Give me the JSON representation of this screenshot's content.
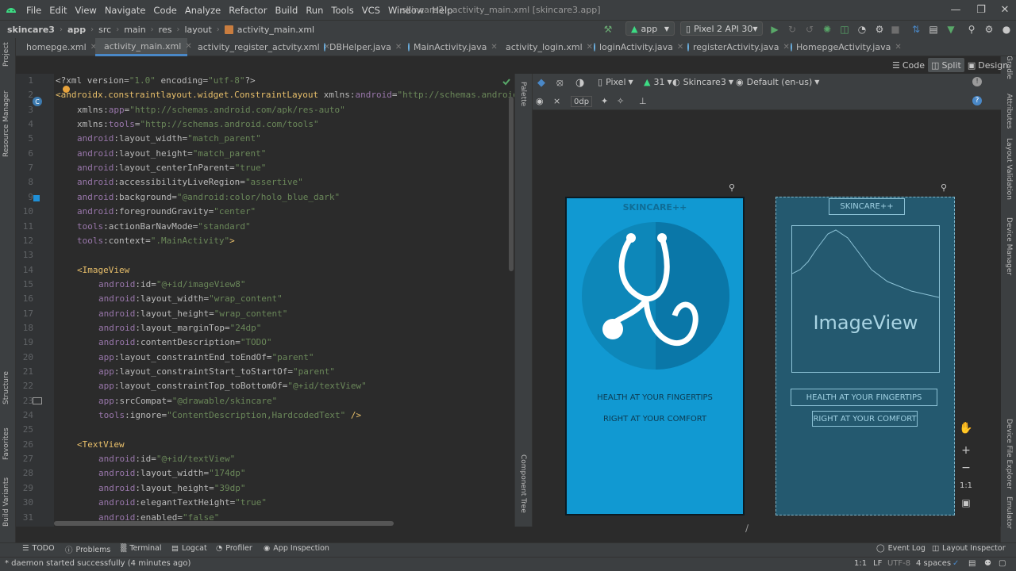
{
  "menu": {
    "items": [
      "File",
      "Edit",
      "View",
      "Navigate",
      "Code",
      "Analyze",
      "Refactor",
      "Build",
      "Run",
      "Tools",
      "VCS",
      "Window",
      "Help"
    ],
    "window_title": "skincare3 - activity_main.xml [skincare3.app]"
  },
  "breadcrumb": [
    "skincare3",
    "app",
    "src",
    "main",
    "res",
    "layout",
    "activity_main.xml"
  ],
  "toolbar": {
    "config_label": "app",
    "device_label": "Pixel 2 API 30"
  },
  "tabs": [
    {
      "label": "homepge.xml",
      "type": "xml"
    },
    {
      "label": "activity_main.xml",
      "type": "xml",
      "active": true
    },
    {
      "label": "activity_register_actvity.xml",
      "type": "xml"
    },
    {
      "label": "DBHelper.java",
      "type": "java"
    },
    {
      "label": "MainActivity.java",
      "type": "java"
    },
    {
      "label": "activity_login.xml",
      "type": "xml"
    },
    {
      "label": "loginActivity.java",
      "type": "java"
    },
    {
      "label": "registerActivity.java",
      "type": "java"
    },
    {
      "label": "HomepgeActivity.java",
      "type": "java"
    }
  ],
  "view_modes": {
    "code": "Code",
    "split": "Split",
    "design": "Design"
  },
  "left_tools": {
    "project": "Project",
    "resource_manager": "Resource Manager",
    "structure": "Structure",
    "favorites": "Favorites",
    "build_variants": "Build Variants"
  },
  "right_tools": {
    "gradle": "Gradle",
    "attributes": "Attributes",
    "layout_validation": "Layout Validation",
    "device_manager": "Device Manager",
    "device_file_explorer": "Device File Explorer",
    "emulator": "Emulator"
  },
  "design_panel": {
    "palette": "Palette",
    "component_tree": "Component Tree",
    "device": "Pixel",
    "api": "31",
    "theme": "Skincare3",
    "locale": "Default (en-us)",
    "margin": "0dp"
  },
  "preview": {
    "title": "SKINCARE++",
    "line1": "HEALTH AT YOUR FINGERTIPS",
    "line2": "RIGHT AT YOUR COMFORT",
    "blueprint_imageview": "ImageView",
    "blue_color": "#0f98d3"
  },
  "code_lines": [
    {
      "n": "1",
      "indent": 0,
      "parts": [
        [
          "prolog",
          "<?xml version="
        ],
        [
          "val",
          "\"1.0\""
        ],
        [
          "prolog",
          " encoding="
        ],
        [
          "val",
          "\"utf-8\""
        ],
        [
          "prolog",
          "?>"
        ]
      ]
    },
    {
      "n": "2",
      "indent": 0,
      "parts": [
        [
          "tag",
          "<androidx.constraintlayout.widget.ConstraintLayout "
        ],
        [
          "attr",
          "xmlns:"
        ],
        [
          "ns",
          "android"
        ],
        [
          "attr",
          "="
        ],
        [
          "val",
          "\"http://schemas.android"
        ]
      ]
    },
    {
      "n": "3",
      "indent": 1,
      "parts": [
        [
          "attr",
          "xmlns:"
        ],
        [
          "ns",
          "app"
        ],
        [
          "attr",
          "="
        ],
        [
          "val",
          "\"http://schemas.android.com/apk/res-auto\""
        ]
      ]
    },
    {
      "n": "4",
      "indent": 1,
      "parts": [
        [
          "attr",
          "xmlns:"
        ],
        [
          "ns",
          "tools"
        ],
        [
          "attr",
          "="
        ],
        [
          "val",
          "\"http://schemas.android.com/tools\""
        ]
      ]
    },
    {
      "n": "5",
      "indent": 1,
      "parts": [
        [
          "ns",
          "android"
        ],
        [
          "attr",
          ":layout_width="
        ],
        [
          "val",
          "\"match_parent\""
        ]
      ]
    },
    {
      "n": "6",
      "indent": 1,
      "parts": [
        [
          "ns",
          "android"
        ],
        [
          "attr",
          ":layout_height="
        ],
        [
          "val",
          "\"match_parent\""
        ]
      ]
    },
    {
      "n": "7",
      "indent": 1,
      "parts": [
        [
          "ns",
          "android"
        ],
        [
          "attr",
          ":layout_centerInParent="
        ],
        [
          "val",
          "\"true\""
        ]
      ]
    },
    {
      "n": "8",
      "indent": 1,
      "parts": [
        [
          "ns",
          "android"
        ],
        [
          "attr",
          ":accessibilityLiveRegion="
        ],
        [
          "val",
          "\"assertive\""
        ]
      ]
    },
    {
      "n": "9",
      "indent": 1,
      "parts": [
        [
          "ns",
          "android"
        ],
        [
          "attr",
          ":background="
        ],
        [
          "val",
          "\"@android:color/holo_blue_dark\""
        ]
      ]
    },
    {
      "n": "10",
      "indent": 1,
      "parts": [
        [
          "ns",
          "android"
        ],
        [
          "attr",
          ":foregroundGravity="
        ],
        [
          "val",
          "\"center\""
        ]
      ]
    },
    {
      "n": "11",
      "indent": 1,
      "parts": [
        [
          "ns",
          "tools"
        ],
        [
          "attr",
          ":actionBarNavMode="
        ],
        [
          "val",
          "\"standard\""
        ]
      ]
    },
    {
      "n": "12",
      "indent": 1,
      "parts": [
        [
          "ns",
          "tools"
        ],
        [
          "attr",
          ":context="
        ],
        [
          "val",
          "\".MainActivity\""
        ],
        [
          "tag",
          ">"
        ]
      ]
    },
    {
      "n": "13",
      "indent": 0,
      "parts": []
    },
    {
      "n": "14",
      "indent": 1,
      "parts": [
        [
          "tag",
          "<ImageView"
        ]
      ]
    },
    {
      "n": "15",
      "indent": 2,
      "parts": [
        [
          "ns",
          "android"
        ],
        [
          "attr",
          ":id="
        ],
        [
          "val",
          "\"@+id/imageView8\""
        ]
      ]
    },
    {
      "n": "16",
      "indent": 2,
      "parts": [
        [
          "ns",
          "android"
        ],
        [
          "attr",
          ":layout_width="
        ],
        [
          "val",
          "\"wrap_content\""
        ]
      ]
    },
    {
      "n": "17",
      "indent": 2,
      "parts": [
        [
          "ns",
          "android"
        ],
        [
          "attr",
          ":layout_height="
        ],
        [
          "val",
          "\"wrap_content\""
        ]
      ]
    },
    {
      "n": "18",
      "indent": 2,
      "parts": [
        [
          "ns",
          "android"
        ],
        [
          "attr",
          ":layout_marginTop="
        ],
        [
          "val",
          "\"24dp\""
        ]
      ]
    },
    {
      "n": "19",
      "indent": 2,
      "parts": [
        [
          "ns",
          "android"
        ],
        [
          "attr",
          ":contentDescription="
        ],
        [
          "val",
          "\"TODO\""
        ]
      ]
    },
    {
      "n": "20",
      "indent": 2,
      "parts": [
        [
          "ns",
          "app"
        ],
        [
          "attr",
          ":layout_constraintEnd_toEndOf="
        ],
        [
          "val",
          "\"parent\""
        ]
      ]
    },
    {
      "n": "21",
      "indent": 2,
      "parts": [
        [
          "ns",
          "app"
        ],
        [
          "attr",
          ":layout_constraintStart_toStartOf="
        ],
        [
          "val",
          "\"parent\""
        ]
      ]
    },
    {
      "n": "22",
      "indent": 2,
      "parts": [
        [
          "ns",
          "app"
        ],
        [
          "attr",
          ":layout_constraintTop_toBottomOf="
        ],
        [
          "val",
          "\"@+id/textView\""
        ]
      ]
    },
    {
      "n": "23",
      "indent": 2,
      "parts": [
        [
          "ns",
          "app"
        ],
        [
          "attr",
          ":srcCompat="
        ],
        [
          "val",
          "\"@drawable/skincare\""
        ]
      ]
    },
    {
      "n": "24",
      "indent": 2,
      "parts": [
        [
          "ns",
          "tools"
        ],
        [
          "attr",
          ":ignore="
        ],
        [
          "val",
          "\"ContentDescription,HardcodedText\""
        ],
        [
          "tag",
          " />"
        ]
      ]
    },
    {
      "n": "25",
      "indent": 0,
      "parts": []
    },
    {
      "n": "26",
      "indent": 1,
      "parts": [
        [
          "tag",
          "<TextView"
        ]
      ]
    },
    {
      "n": "27",
      "indent": 2,
      "parts": [
        [
          "ns",
          "android"
        ],
        [
          "attr",
          ":id="
        ],
        [
          "val",
          "\"@+id/textView\""
        ]
      ]
    },
    {
      "n": "28",
      "indent": 2,
      "parts": [
        [
          "ns",
          "android"
        ],
        [
          "attr",
          ":layout_width="
        ],
        [
          "val",
          "\"174dp\""
        ]
      ]
    },
    {
      "n": "29",
      "indent": 2,
      "parts": [
        [
          "ns",
          "android"
        ],
        [
          "attr",
          ":layout_height="
        ],
        [
          "val",
          "\"39dp\""
        ]
      ]
    },
    {
      "n": "30",
      "indent": 2,
      "parts": [
        [
          "ns",
          "android"
        ],
        [
          "attr",
          ":elegantTextHeight="
        ],
        [
          "val",
          "\"true\""
        ]
      ]
    },
    {
      "n": "31",
      "indent": 2,
      "parts": [
        [
          "ns",
          "android"
        ],
        [
          "attr",
          ":enabled="
        ],
        [
          "val",
          "\"false\""
        ]
      ]
    }
  ],
  "bottom_tools": [
    "TODO",
    "Problems",
    "Terminal",
    "Logcat",
    "Profiler",
    "App Inspection"
  ],
  "bottom_right_tools": [
    "Event Log",
    "Layout Inspector"
  ],
  "status": {
    "message": "* daemon started successfully (4 minutes ago)",
    "position": "1:1",
    "line_sep": "LF",
    "encoding": "UTF-8",
    "indent": "4 spaces"
  }
}
